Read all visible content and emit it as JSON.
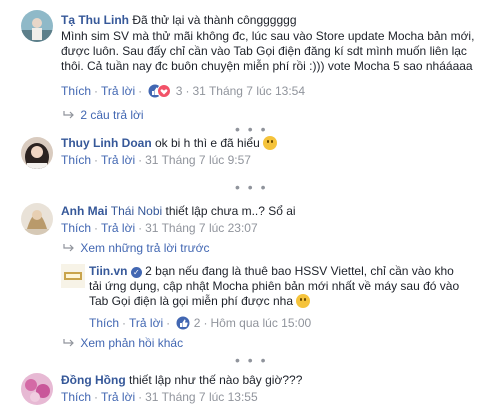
{
  "comments": [
    {
      "author": "Tạ Thu Linh",
      "text_head": "Đã thử lại và thành côngggggg",
      "text_body": [
        "Mình sim SV mà thử mãi không đc, lúc sau vào Store update Mocha bản mới,",
        "được luôn. Sau đấy chỉ cần vào Tab Gọi điện đăng kí sdt mình muốn liên lạc",
        "thôi. Cả tuần nay đc buôn chuyện miễn phí rồi :))) vote Mocha 5 sao nhááaaa"
      ],
      "like": "Thích",
      "reply": "Trả lời",
      "reaction_count": "3",
      "time": "31 Tháng 7 lúc 13:54",
      "replies_link": "2 câu trả lời"
    },
    {
      "author": "Thuy Linh Doan",
      "text": "ok bi h thì e đã hiểu",
      "like": "Thích",
      "reply": "Trả lời",
      "time": "31 Tháng 7 lúc 9:57"
    },
    {
      "author": "Anh Mai",
      "mention": "Thái Nobi",
      "text": "thiết lập chưa m..? Sổ ai",
      "like": "Thích",
      "reply": "Trả lời",
      "time": "31 Tháng 7 lúc 23:07",
      "prev_link": "Xem những trả lời trước",
      "reply_item": {
        "author": "Tiin.vn",
        "lines": [
          "2 bạn nếu đang là thuê bao HSSV Viettel, chỉ cần vào kho",
          "tải ứng dụng, cập nhật Mocha phiên bản mới nhất về máy sau đó vào",
          "Tab Gọi điện là gọi miễn phí được nha"
        ],
        "like": "Thích",
        "reply": "Trả lời",
        "reaction_count": "2",
        "time": "Hôm qua lúc 15:00"
      },
      "more_link": "Xem phản hồi khác"
    },
    {
      "author": "Đồng Hồng",
      "text": "thiết lập như thế nào bây giờ???",
      "like": "Thích",
      "reply": "Trả lời",
      "time": "31 Tháng 7 lúc 13:55"
    }
  ],
  "dots": "• • •",
  "colors": {
    "link": "#365899",
    "action": "#4267b2",
    "muted": "#90949c"
  }
}
